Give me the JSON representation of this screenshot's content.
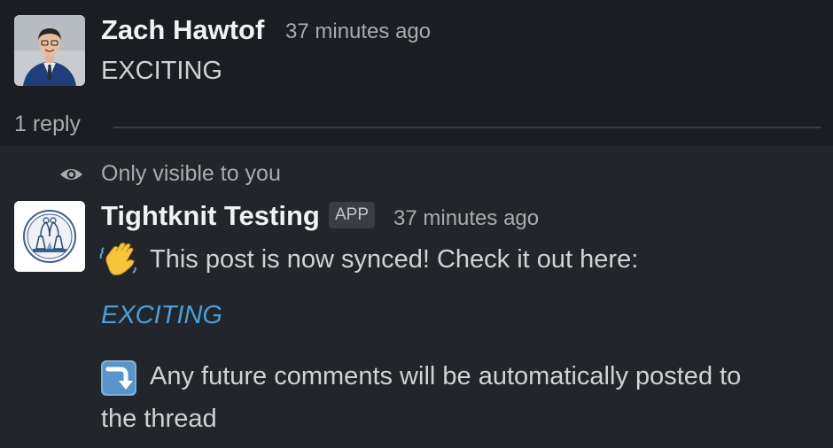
{
  "messages": [
    {
      "author": "Zach Hawtof",
      "timestamp": "37 minutes ago",
      "text": "EXCITING",
      "avatar_icon": "user-photo-avatar"
    }
  ],
  "thread": {
    "reply_count": "1 reply"
  },
  "ephemeral": {
    "visibility_note": "Only visible to you",
    "visibility_icon": "eye-icon",
    "author": "Tightknit Testing",
    "badge": "APP",
    "timestamp": "37 minutes ago",
    "line1_emoji": "waving-hand-icon",
    "line1": "This post is now synced! Check it out here:",
    "link_text": "EXCITING",
    "line2_emoji": "arrow-curving-down-icon",
    "line2a": "Any future comments will be automatically posted to",
    "line2b": "the thread"
  },
  "colors": {
    "link": "#4a9fd8",
    "background_top": "#1a1d21",
    "background_bottom": "#222529"
  }
}
